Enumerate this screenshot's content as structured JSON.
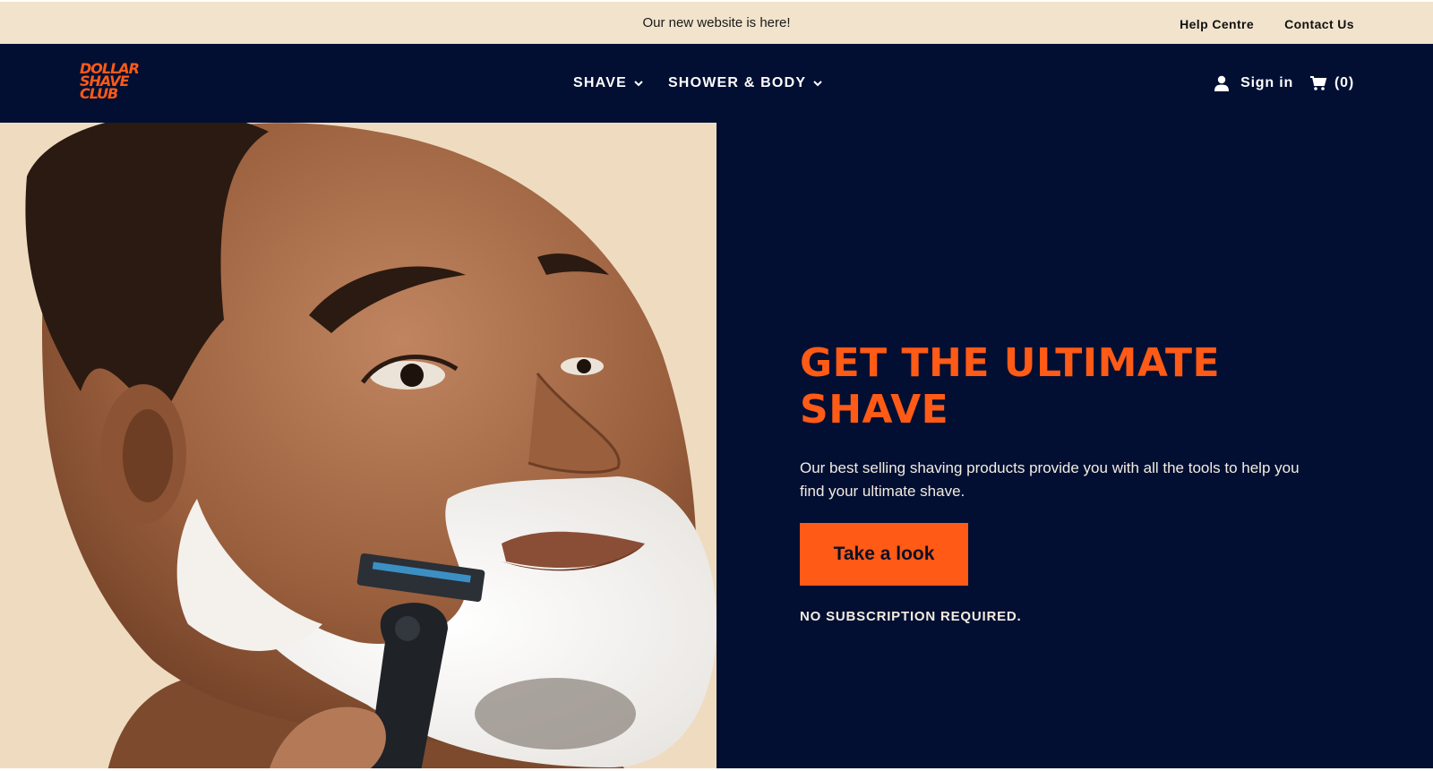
{
  "announcement": {
    "text": "Our new website is here!",
    "links": [
      "Help Centre",
      "Contact Us"
    ]
  },
  "header": {
    "logo_lines": [
      "DOLLAR",
      "SHAVE",
      "CLUB"
    ],
    "nav": [
      {
        "label": "SHAVE",
        "icon": "chevron-down-icon"
      },
      {
        "label": "SHOWER & BODY",
        "icon": "chevron-down-icon"
      }
    ],
    "signin_label": "Sign in",
    "cart_label": "(0)"
  },
  "hero": {
    "title": "GET THE ULTIMATE SHAVE",
    "description": "Our best selling shaving products provide you with all the tools to help you find your ultimate shave.",
    "cta_label": "Take a look",
    "note": "NO SUBSCRIPTION REQUIRED."
  },
  "colors": {
    "navy": "#020f33",
    "orange": "#ff5a16",
    "cream": "#f1e3cc"
  }
}
